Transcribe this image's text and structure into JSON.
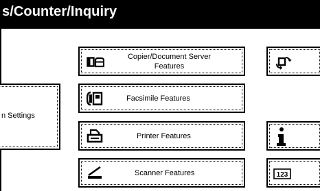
{
  "header": {
    "title": "s/Counter/Inquiry"
  },
  "features": {
    "copier_label_line1": "Copier/Document Server",
    "copier_label_line2": "Features",
    "fax_label": "Facsimile Features",
    "printer_label": "Printer Features",
    "scanner_label": "Scanner Features"
  },
  "left_panel": {
    "settings_label": "n Settings"
  },
  "icons": {
    "copier": "copier-document-server-icon",
    "fax": "facsimile-icon",
    "printer": "printer-icon",
    "scanner": "scanner-icon",
    "language": "language-switch-icon",
    "inquiry": "info-icon",
    "counter": "counter-icon",
    "counter_text": "123"
  }
}
